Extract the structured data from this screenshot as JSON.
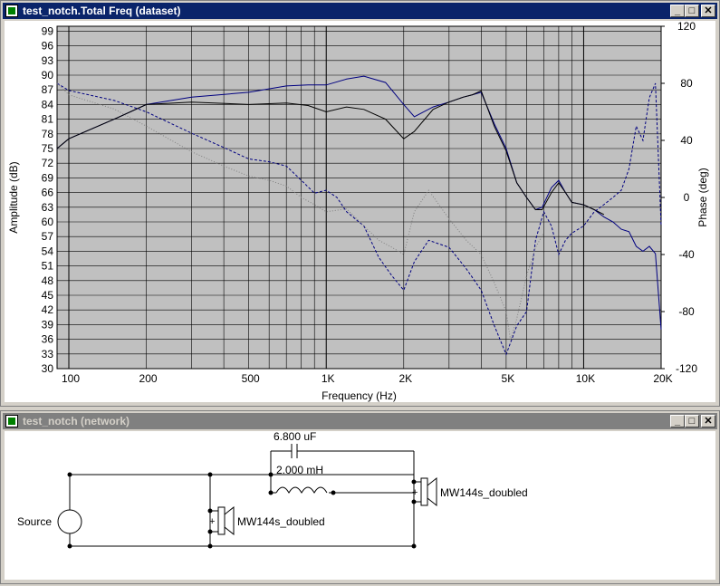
{
  "freq_window": {
    "title": "test_notch.Total Freq (dataset)",
    "buttons": {
      "minimize": "_",
      "maximize": "□",
      "close": "✕"
    }
  },
  "network_window": {
    "title": "test_notch (network)",
    "buttons": {
      "minimize": "_",
      "maximize": "□",
      "close": "✕"
    }
  },
  "colors": {
    "active_title": "#0a246a",
    "inactive_title": "#808080",
    "plot_bg": "#c0c0c0",
    "trace": "#000080"
  },
  "chart_data": {
    "type": "line",
    "xlabel": "Frequency (Hz)",
    "ylabel_left": "Amplitude (dB)",
    "ylabel_right": "Phase (deg)",
    "x_scale": "log",
    "xlim": [
      90,
      20000
    ],
    "ylim_left": [
      30,
      100
    ],
    "ylim_right": [
      -120,
      120
    ],
    "x_ticks": [
      {
        "v": 100,
        "label": "100"
      },
      {
        "v": 200,
        "label": "200"
      },
      {
        "v": 500,
        "label": "500"
      },
      {
        "v": 1000,
        "label": "1K"
      },
      {
        "v": 2000,
        "label": "2K"
      },
      {
        "v": 5000,
        "label": "5K"
      },
      {
        "v": 10000,
        "label": "10K"
      },
      {
        "v": 20000,
        "label": "20K"
      }
    ],
    "y_ticks_left": [
      "99",
      "96",
      "93",
      "90",
      "87",
      "84",
      "81",
      "78",
      "75",
      "72",
      "69",
      "66",
      "63",
      "60",
      "57",
      "54",
      "51",
      "48",
      "45",
      "42",
      "39",
      "36",
      "33",
      "30"
    ],
    "y_ticks_right": [
      "120",
      "80",
      "40",
      "0",
      "-40",
      "-80",
      "-120"
    ],
    "grid": true,
    "series": [
      {
        "style": "solid",
        "color": "#000080",
        "axis": "left",
        "x": [
          90,
          100,
          150,
          200,
          300,
          500,
          700,
          850,
          1000,
          1200,
          1400,
          1700,
          2000,
          2200,
          2600,
          3000,
          3400,
          3700,
          4000,
          4500,
          5000,
          5500,
          6000,
          6500,
          6900,
          7500,
          8000,
          8500,
          9000,
          10000,
          11000,
          12000,
          13000,
          14000,
          15000,
          16000,
          17000,
          18000,
          19000,
          20000
        ],
        "y": [
          75,
          77,
          81,
          84,
          85.5,
          86.5,
          87.8,
          88,
          88,
          89.2,
          89.8,
          88.5,
          84,
          81.5,
          83.5,
          84.5,
          85.5,
          86,
          86.5,
          80,
          75,
          68,
          65,
          62.5,
          63,
          67,
          68.5,
          66,
          64,
          63.5,
          62.5,
          61,
          60,
          58.5,
          58,
          55,
          54,
          55,
          53.5,
          38
        ]
      },
      {
        "style": "solid",
        "color": "#000000",
        "axis": "left",
        "x": [
          90,
          100,
          150,
          200,
          300,
          500,
          700,
          850,
          1000,
          1200,
          1400,
          1700,
          2000,
          2200,
          2600,
          3000,
          3400,
          3700,
          4000,
          4500,
          5000,
          5500,
          6000,
          6500,
          6900,
          7500,
          8000,
          8500,
          9000,
          10000,
          11000,
          12000
        ],
        "y": [
          75,
          77,
          81,
          84,
          84.5,
          84,
          84.3,
          83.8,
          82.5,
          83.5,
          83,
          81,
          77,
          78.5,
          83,
          84.5,
          85.5,
          86,
          86.8,
          79.5,
          74.5,
          68,
          65,
          62.5,
          62.5,
          66,
          68,
          66,
          64,
          63.5,
          62.5,
          61.5
        ]
      },
      {
        "style": "dashed",
        "color": "#000080",
        "axis": "right",
        "x": [
          90,
          100,
          150,
          200,
          300,
          400,
          500,
          600,
          700,
          800,
          900,
          1000,
          1100,
          1200,
          1400,
          1600,
          1800,
          2000,
          2200,
          2500,
          3000,
          3500,
          4000,
          4500,
          5000,
          5500,
          6000,
          6500,
          7000,
          7500,
          8000,
          8500,
          9000,
          10000,
          11000,
          12000,
          13000,
          14000,
          15000,
          16000,
          17000,
          18000,
          19000,
          20000
        ],
        "y": [
          80,
          75,
          68,
          60,
          45,
          35,
          27,
          25,
          22,
          12,
          3,
          5,
          0,
          -10,
          -20,
          -42,
          -55,
          -65,
          -45,
          -30,
          -35,
          -50,
          -65,
          -90,
          -110,
          -90,
          -80,
          -30,
          -10,
          -20,
          -40,
          -30,
          -25,
          -20,
          -10,
          -5,
          0,
          5,
          20,
          50,
          40,
          70,
          80,
          -20
        ]
      },
      {
        "style": "dotted",
        "color": "#808080",
        "axis": "right",
        "x": [
          90,
          100,
          150,
          200,
          300,
          400,
          500,
          600,
          700,
          800,
          900,
          1000,
          1200,
          1400,
          1600,
          1800,
          2000,
          2200,
          2500,
          3000,
          3500,
          4000,
          4500,
          5000,
          5200,
          5500,
          6000,
          6500,
          7000
        ],
        "y": [
          80,
          72,
          62,
          50,
          32,
          22,
          15,
          12,
          8,
          0,
          -5,
          -10,
          -8,
          -20,
          -30,
          -35,
          -40,
          -10,
          5,
          -15,
          -30,
          -40,
          -60,
          -80,
          -100,
          -85,
          -55,
          -35,
          -25
        ]
      }
    ]
  },
  "schematic": {
    "capacitor_value": "6.800 uF",
    "inductor_value": "2.000 mH",
    "source_label": "Source",
    "driver1_label": "MW144s_doubled",
    "driver2_label": "MW144s_doubled",
    "plus_sign": "+"
  }
}
